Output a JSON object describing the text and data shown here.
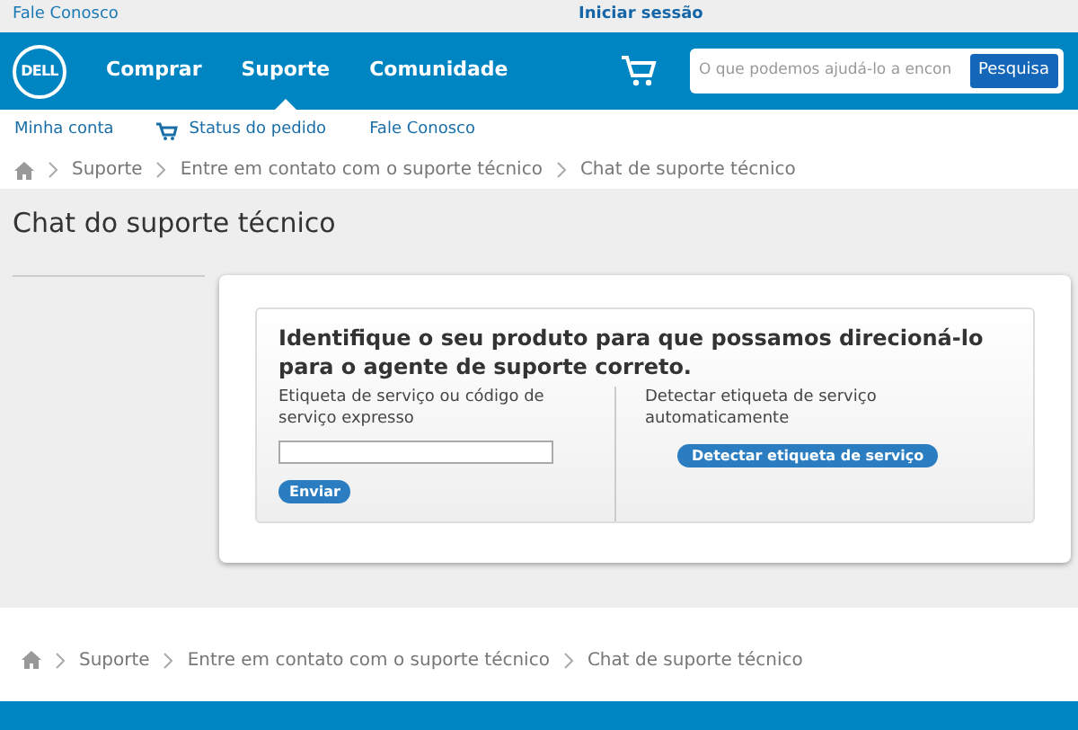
{
  "top_bar": {
    "contact_link": "Fale Conosco",
    "sign_in": "Iniciar sessão"
  },
  "nav": {
    "logo": "DELL",
    "items": [
      {
        "label": "Comprar",
        "selected": false
      },
      {
        "label": "Suporte",
        "selected": true
      },
      {
        "label": "Comunidade",
        "selected": false
      }
    ],
    "search": {
      "placeholder": "O que podemos ajudá-lo a encon",
      "button": "Pesquisa"
    }
  },
  "sub_nav": [
    {
      "label": "Minha conta",
      "kind": "text"
    },
    {
      "label": "Status do pedido",
      "kind": "icon"
    },
    {
      "label": "Fale Conosco",
      "kind": "text"
    }
  ],
  "breadcrumb": [
    "Suporte",
    "Entre em contato com o suporte técnico",
    "Chat de suporte técnico"
  ],
  "page_title": "Chat do suporte técnico",
  "card": {
    "heading": "Identifique o seu produto para que possamos direcioná-lo para o agente de suporte correto.",
    "field_label": "Etiqueta de serviço ou código de serviço expresso",
    "submit": "Enviar",
    "detect_label": "Detectar etiqueta de serviço automaticamente",
    "detect_button": "Detectar etiqueta de serviço"
  },
  "footer_breadcrumb": [
    "Suporte",
    "Entre em contato com o suporte técnico",
    "Chat de suporte técnico"
  ]
}
